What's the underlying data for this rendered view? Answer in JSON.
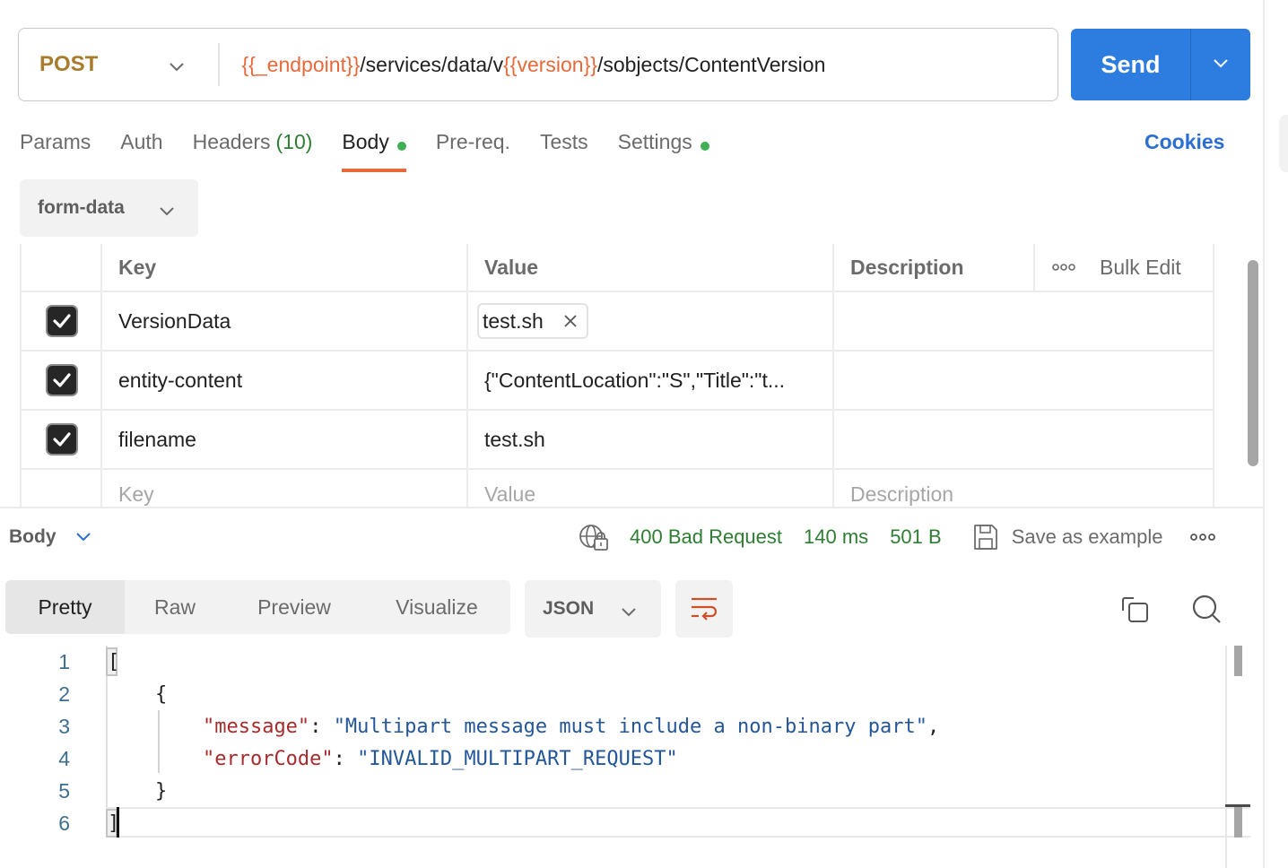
{
  "request": {
    "method": "POST",
    "url_parts": [
      {
        "text": "{{_endpoint}}",
        "type": "variable"
      },
      {
        "text": "/services/data/v",
        "type": "plain"
      },
      {
        "text": "{{version}}",
        "type": "variable"
      },
      {
        "text": "/sobjects/ContentVersion",
        "type": "plain"
      }
    ],
    "send_label": "Send"
  },
  "tabs": [
    {
      "label": "Params",
      "active": false
    },
    {
      "label": "Auth",
      "active": false
    },
    {
      "label": "Headers",
      "count": "(10)",
      "active": false
    },
    {
      "label": "Body",
      "dot": true,
      "active": true
    },
    {
      "label": "Pre-req.",
      "active": false
    },
    {
      "label": "Tests",
      "active": false
    },
    {
      "label": "Settings",
      "dot": true,
      "active": false
    }
  ],
  "cookies_label": "Cookies",
  "body_type": "form-data",
  "table": {
    "headers": {
      "key": "Key",
      "value": "Value",
      "description": "Description",
      "bulk_edit": "Bulk Edit"
    },
    "rows": [
      {
        "checked": true,
        "key": "VersionData",
        "value": "test.sh",
        "value_is_file": true,
        "description": ""
      },
      {
        "checked": true,
        "key": "entity-content",
        "value": "{\"ContentLocation\":\"S\",\"Title\":\"t...",
        "value_is_file": false,
        "description": ""
      },
      {
        "checked": true,
        "key": "filename",
        "value": "test.sh",
        "value_is_file": false,
        "description": ""
      }
    ],
    "placeholders": {
      "key": "Key",
      "value": "Value",
      "description": "Description"
    }
  },
  "response": {
    "section_label": "Body",
    "status": "400 Bad Request",
    "time": "140 ms",
    "size": "501 B",
    "save_example_label": "Save as example",
    "view_modes": [
      {
        "label": "Pretty",
        "active": true
      },
      {
        "label": "Raw",
        "active": false
      },
      {
        "label": "Preview",
        "active": false
      },
      {
        "label": "Visualize",
        "active": false
      }
    ],
    "format": "JSON",
    "lines": [
      {
        "n": "1"
      },
      {
        "n": "2"
      },
      {
        "n": "3"
      },
      {
        "n": "4"
      },
      {
        "n": "5"
      },
      {
        "n": "6"
      }
    ],
    "json": {
      "open_bracket": "[",
      "open_brace": "{",
      "message_key": "\"message\"",
      "message_value": "\"Multipart message must include a non-binary part\"",
      "error_key": "\"errorCode\"",
      "error_value": "\"INVALID_MULTIPART_REQUEST\"",
      "close_brace": "}",
      "close_bracket": "]",
      "colon": ": ",
      "comma": ","
    }
  },
  "colors": {
    "accent_orange": "#e8693a",
    "send_blue": "#2d7de0",
    "status_green": "#2e7d32",
    "method_post": "#a87c2a"
  }
}
